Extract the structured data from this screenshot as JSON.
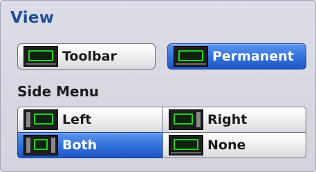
{
  "view": {
    "title": "View",
    "toolbar_button": {
      "label": "Toolbar",
      "selected": false
    },
    "permanent_button": {
      "label": "Permanent",
      "selected": true
    }
  },
  "side_menu": {
    "title": "Side Menu",
    "options": [
      {
        "id": "left",
        "label": "Left",
        "icon": "screen-left-menu-icon",
        "selected": false
      },
      {
        "id": "right",
        "label": "Right",
        "icon": "screen-right-menu-icon",
        "selected": false
      },
      {
        "id": "both",
        "label": "Both",
        "icon": "screen-both-menu-icon",
        "selected": true
      },
      {
        "id": "none",
        "label": "None",
        "icon": "screen-no-menu-icon",
        "selected": false
      }
    ]
  },
  "colors": {
    "title_blue": "#1f4f9a",
    "selected_blue": "#3473de",
    "screen_green": "#22d022"
  }
}
